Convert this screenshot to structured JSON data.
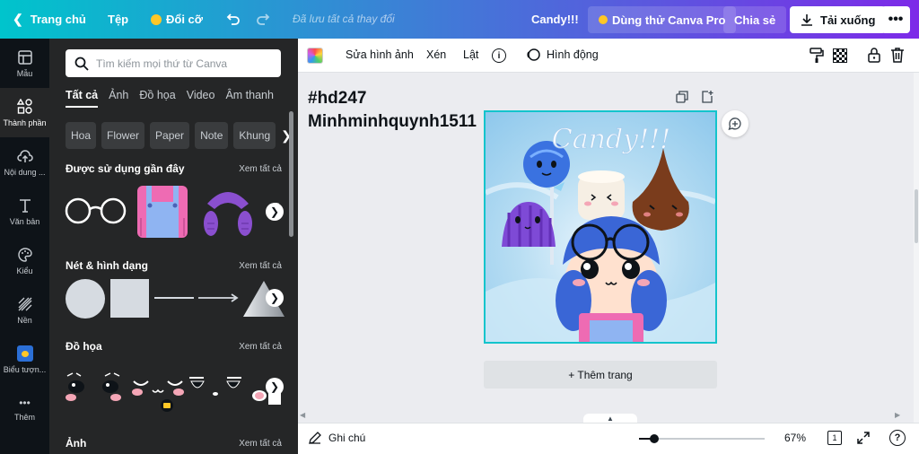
{
  "topbar": {
    "home": "Trang chủ",
    "file": "Tệp",
    "resize": "Đổi cỡ",
    "saved_status": "Đã lưu tất cả thay đổi",
    "design_name": "Candy!!!",
    "try_pro": "Dùng thử Canva Pro",
    "share": "Chia sẻ",
    "download": "Tải xuống"
  },
  "rail": {
    "items": [
      {
        "label": "Mẫu"
      },
      {
        "label": "Thành phần"
      },
      {
        "label": "Nội dung ..."
      },
      {
        "label": "Văn bản"
      },
      {
        "label": "Kiểu"
      },
      {
        "label": "Nền"
      },
      {
        "label": "Biểu tượn..."
      },
      {
        "label": "Thêm"
      }
    ]
  },
  "panel": {
    "search_placeholder": "Tìm kiếm mọi thứ từ Canva",
    "tabs": [
      "Tất cả",
      "Ảnh",
      "Đồ họa",
      "Video",
      "Âm thanh"
    ],
    "chips": [
      "Hoa",
      "Flower",
      "Paper",
      "Note",
      "Khung"
    ],
    "sections": [
      {
        "title": "Được sử dụng gần đây",
        "see_all": "Xem tất cả"
      },
      {
        "title": "Nét & hình dạng",
        "see_all": "Xem tất cả"
      },
      {
        "title": "Đồ họa",
        "see_all": "Xem tất cả"
      },
      {
        "title": "Ảnh",
        "see_all": "Xem tất cả"
      }
    ]
  },
  "toolbar": {
    "edit_image": "Sửa hình ảnh",
    "crop": "Xén",
    "flip": "Lật",
    "animate": "Hình động"
  },
  "canvas": {
    "heading_line1": "#hd247",
    "heading_line2": "Minhminhquynh1511",
    "design_text": "Candy!!!",
    "add_page": "+ Thêm trang"
  },
  "bottombar": {
    "notes": "Ghi chú",
    "zoom": "67%",
    "page_count": "1",
    "zoom_fraction": 0.12
  },
  "colors": {
    "accent_teal": "#00c4cc",
    "accent_purple": "#7d2ae8",
    "panel_bg": "#252627",
    "rail_bg": "#0e1318",
    "selection": "#13c4cc"
  }
}
